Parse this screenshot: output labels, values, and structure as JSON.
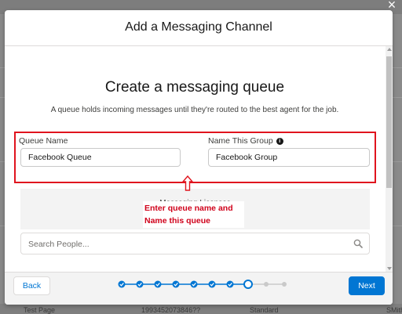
{
  "modal": {
    "title": "Add a Messaging Channel",
    "close_icon": "close-icon"
  },
  "body": {
    "heading": "Create a messaging queue",
    "subtitle": "A queue holds incoming messages until they're routed to the best agent for the job.",
    "queue_name": {
      "label": "Queue Name",
      "value": "Facebook Queue"
    },
    "group_name": {
      "label": "Name This Group",
      "value": "Facebook Group",
      "info_icon": "info-icon"
    },
    "licenses_label": "Messaging Licenses",
    "annotation": {
      "line1": "Enter queue name and",
      "line2": "Name this queue",
      "color": "#d0021b"
    },
    "search": {
      "placeholder": "Search People...",
      "icon": "search-icon"
    }
  },
  "footer": {
    "back_label": "Back",
    "next_label": "Next",
    "progress": {
      "total_steps": 10,
      "completed_steps": 7,
      "current_step": 8
    }
  },
  "background": {
    "bottom_row": [
      "Test Page",
      "1993452073846??",
      "Standard",
      "SMith"
    ]
  },
  "colors": {
    "brand": "#0176d3",
    "annotation_red": "#e0141e"
  }
}
